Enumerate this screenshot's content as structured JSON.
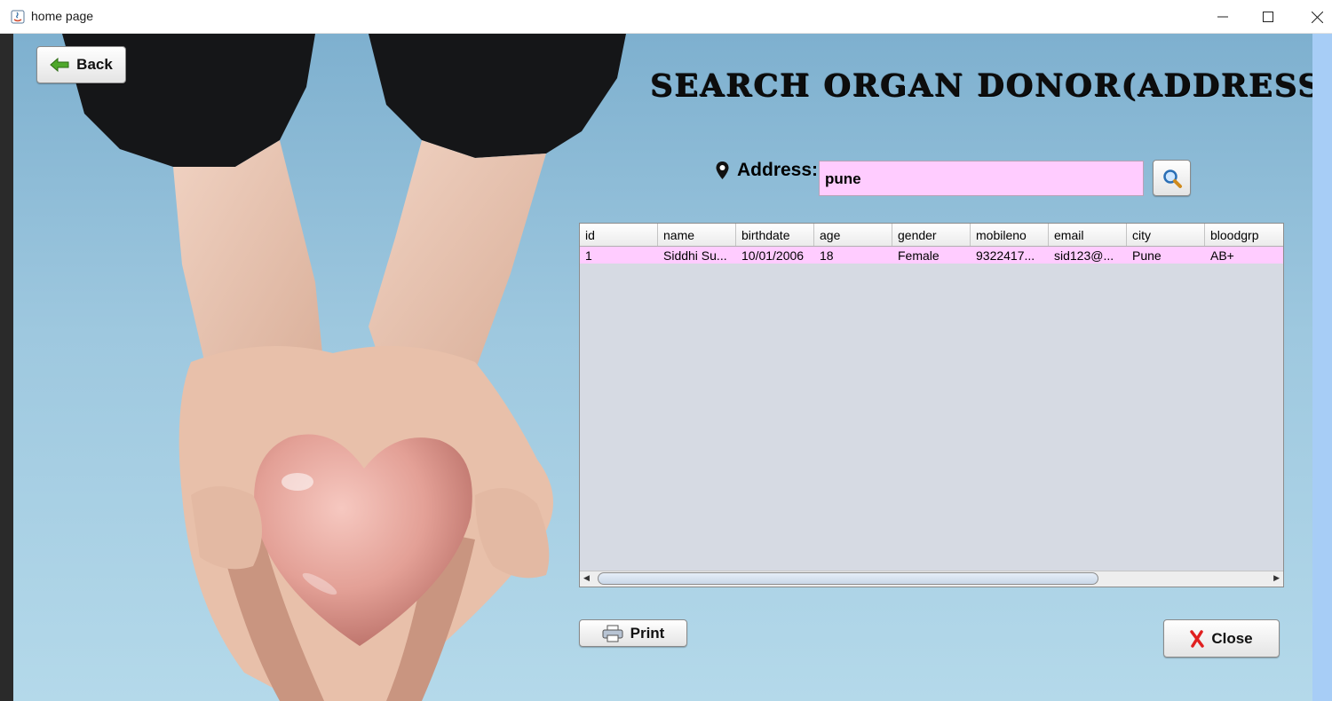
{
  "window": {
    "title": "home page",
    "controls": {
      "minimize": "minimize-icon",
      "maximize": "maximize-icon",
      "close": "close-window-icon"
    }
  },
  "toolbar": {
    "back_label": "Back"
  },
  "heading": "SEARCH ORGAN DONOR(ADDRESS)",
  "search": {
    "label": "Address:",
    "value": "pune"
  },
  "table": {
    "columns": [
      "id",
      "name",
      "birthdate",
      "age",
      "gender",
      "mobileno",
      "email",
      "city",
      "bloodgrp"
    ],
    "rows": [
      [
        "1",
        "Siddhi Su...",
        "10/01/2006",
        "18",
        "Female",
        "9322417...",
        "sid123@...",
        "Pune",
        "AB+"
      ]
    ]
  },
  "actions": {
    "print_label": "Print",
    "close_label": "Close"
  },
  "colors": {
    "highlight": "#ffccff",
    "table_bg": "#d6dae3",
    "accent": "#a7cdf6"
  }
}
